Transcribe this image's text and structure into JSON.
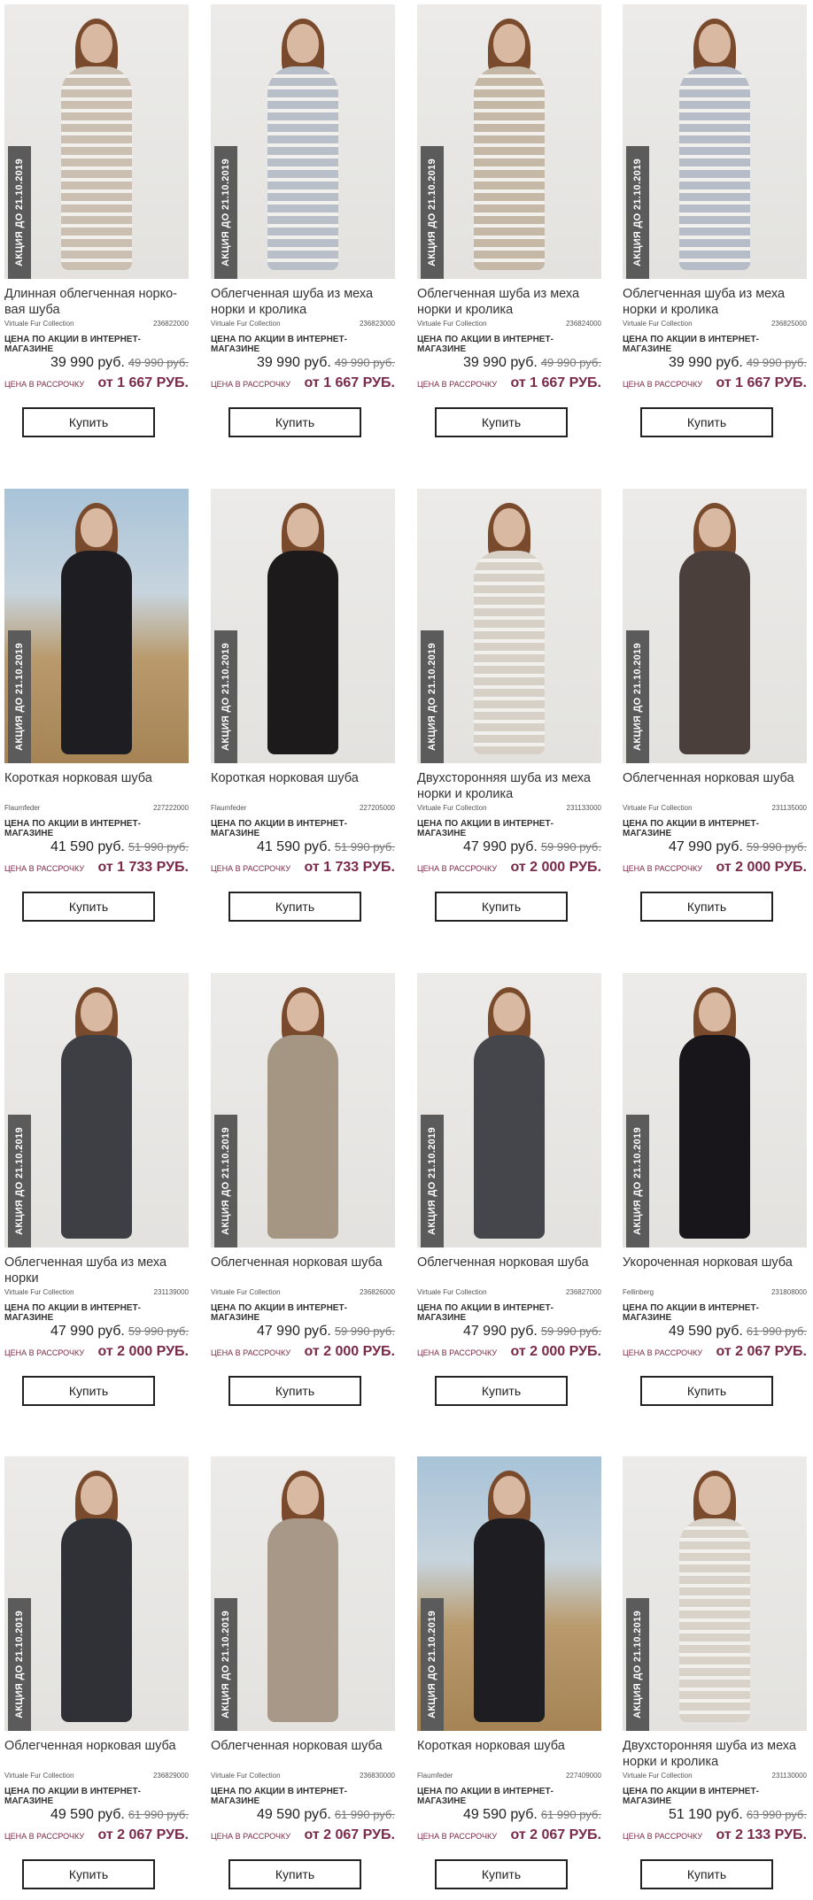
{
  "products": [
    {
      "title": "Длинная облегченная норко-вая шуба",
      "brand": "Virtuale Fur Collection",
      "sku": "236822000",
      "price": "39 990 руб.",
      "old_price": "49 990 руб.",
      "installment": "от 1 667 РУБ.",
      "coat_color": "#cbbfb1",
      "stripe": true,
      "outdoor": false
    },
    {
      "title": "Облегченная шуба из меха норки и кролика",
      "brand": "Virtuale Fur Collection",
      "sku": "236823000",
      "price": "39 990 руб.",
      "old_price": "49 990 руб.",
      "installment": "от 1 667 РУБ.",
      "coat_color": "#b8bfc9",
      "stripe": true,
      "outdoor": false
    },
    {
      "title": "Облегченная шуба из меха норки и кролика",
      "brand": "Virtuale Fur Collection",
      "sku": "236824000",
      "price": "39 990 руб.",
      "old_price": "49 990 руб.",
      "installment": "от 1 667 РУБ.",
      "coat_color": "#c6b8a6",
      "stripe": true,
      "outdoor": false
    },
    {
      "title": "Облегченная шуба из меха норки и кролика",
      "brand": "Virtuale Fur Collection",
      "sku": "236825000",
      "price": "39 990 руб.",
      "old_price": "49 990 руб.",
      "installment": "от 1 667 РУБ.",
      "coat_color": "#b6bcc8",
      "stripe": true,
      "outdoor": false
    },
    {
      "title": "Короткая норковая шуба",
      "brand": "Flaumfeder",
      "sku": "227222000",
      "price": "41 590 руб.",
      "old_price": "51 990 руб.",
      "installment": "от 1 733 РУБ.",
      "coat_color": "#1e1e22",
      "stripe": false,
      "outdoor": true
    },
    {
      "title": "Короткая норковая шуба",
      "brand": "Flaumfeder",
      "sku": "227205000",
      "price": "41 590 руб.",
      "old_price": "51 990 руб.",
      "installment": "от 1 733 РУБ.",
      "coat_color": "#1c1a1b",
      "stripe": false,
      "outdoor": false
    },
    {
      "title": "Двухсторонняя шуба из меха норки и кролика",
      "brand": "Virtuale Fur Collection",
      "sku": "231133000",
      "price": "47 990 руб.",
      "old_price": "59 990 руб.",
      "installment": "от 2 000 РУБ.",
      "coat_color": "#d7d0c6",
      "stripe": true,
      "outdoor": false
    },
    {
      "title": "Облегченная норковая шуба",
      "brand": "Virtuale Fur Collection",
      "sku": "231135000",
      "price": "47 990 руб.",
      "old_price": "59 990 руб.",
      "installment": "от 2 000 РУБ.",
      "coat_color": "#4a3f3b",
      "stripe": false,
      "outdoor": false
    },
    {
      "title": "Облегченная шуба из меха норки",
      "brand": "Virtuale Fur Collection",
      "sku": "231139000",
      "price": "47 990 руб.",
      "old_price": "59 990 руб.",
      "installment": "от 2 000 РУБ.",
      "coat_color": "#3d3f45",
      "stripe": false,
      "outdoor": false
    },
    {
      "title": "Облегченная норковая шуба",
      "brand": "Virtuale Fur Collection",
      "sku": "236826000",
      "price": "47 990 руб.",
      "old_price": "59 990 руб.",
      "installment": "от 2 000 РУБ.",
      "coat_color": "#a59684",
      "stripe": false,
      "outdoor": false
    },
    {
      "title": "Облегченная норковая шуба",
      "brand": "Virtuale Fur Collection",
      "sku": "236827000",
      "price": "47 990 руб.",
      "old_price": "59 990 руб.",
      "installment": "от 2 000 РУБ.",
      "coat_color": "#44464c",
      "stripe": false,
      "outdoor": false
    },
    {
      "title": "Укороченная норковая шуба",
      "brand": "Fellinberg",
      "sku": "231808000",
      "price": "49 590 руб.",
      "old_price": "61 990 руб.",
      "installment": "от 2 067 РУБ.",
      "coat_color": "#18161a",
      "stripe": false,
      "outdoor": false
    },
    {
      "title": "Облегченная норковая шуба",
      "brand": "Virtuale Fur Collection",
      "sku": "236829000",
      "price": "49 590 руб.",
      "old_price": "61 990 руб.",
      "installment": "от 2 067 РУБ.",
      "coat_color": "#2f3136",
      "stripe": false,
      "outdoor": false
    },
    {
      "title": "Облегченная норковая шуба",
      "brand": "Virtuale Fur Collection",
      "sku": "236830000",
      "price": "49 590 руб.",
      "old_price": "61 990 руб.",
      "installment": "от 2 067 РУБ.",
      "coat_color": "#a89887",
      "stripe": false,
      "outdoor": false
    },
    {
      "title": "Короткая норковая шуба",
      "brand": "Flaumfeder",
      "sku": "227409000",
      "price": "49 590 руб.",
      "old_price": "61 990 руб.",
      "installment": "от 2 067 РУБ.",
      "coat_color": "#1e1e22",
      "stripe": false,
      "outdoor": true
    },
    {
      "title": "Двухсторонняя шуба из меха норки и кролика",
      "brand": "Virtuale Fur Collection",
      "sku": "231130000",
      "price": "51 190 руб.",
      "old_price": "63 990 руб.",
      "installment": "от 2 133 РУБ.",
      "coat_color": "#d9d2c8",
      "stripe": true,
      "outdoor": false
    }
  ],
  "labels": {
    "badge": "АКЦИЯ ДО 21.10.2019",
    "promo": "ЦЕНА ПО АКЦИИ В ИНТЕРНЕТ-МАГАЗИНЕ",
    "installment": "ЦЕНА В РАССРОЧКУ",
    "buy": "Купить"
  }
}
